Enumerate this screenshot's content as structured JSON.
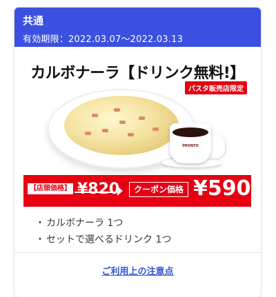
{
  "header": {
    "category": "共通",
    "period_label": "有効期限：",
    "period": "2022.03.07〜2022.03.13"
  },
  "product": {
    "title": "カルボナーラ【ドリンク無料!】",
    "badge": "パスタ販売店限定",
    "cup_logo": "PRONTO"
  },
  "price": {
    "store_label": "【店頭価格】",
    "store_price": "¥820",
    "coupon_label": "クーポン価格",
    "coupon_price": "¥590"
  },
  "items": [
    "カルボナーラ 1つ",
    "セットで選べるドリンク 1つ"
  ],
  "footer": {
    "notice_link": "ご利用上の注意点"
  },
  "colors": {
    "header_bg": "#3b50e0",
    "price_bar": "#e60012",
    "link": "#2f55d4"
  }
}
